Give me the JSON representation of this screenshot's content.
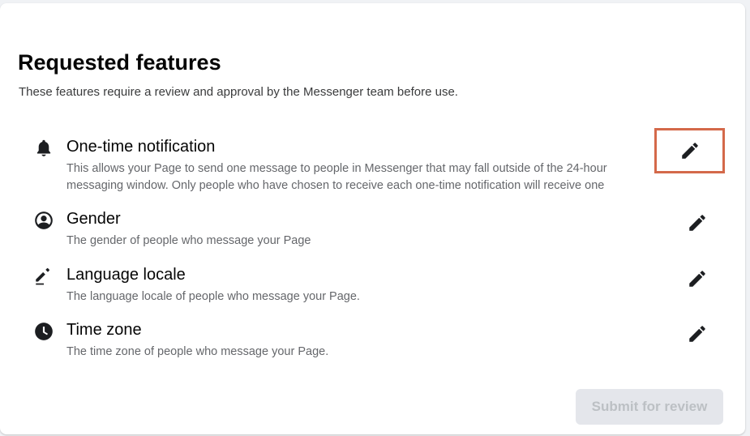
{
  "header": {
    "title": "Requested features",
    "subtitle": "These features require a review and approval by the Messenger team before use."
  },
  "features": [
    {
      "name": "One-time notification",
      "icon": "bell-icon",
      "description_lines": [
        "This allows your Page to send one message to people in Messenger that may fall outside of the 24-hour",
        "messaging window. Only people who have chosen to receive each one-time notification will receive one"
      ],
      "edit_icon": "pencil-icon",
      "edit_highlighted": true
    },
    {
      "name": "Gender",
      "icon": "person-circle-icon",
      "description_lines": [
        "The gender of people who message your Page"
      ],
      "edit_icon": "pencil-icon"
    },
    {
      "name": "Language locale",
      "icon": "pen-icon",
      "description_lines": [
        "The language locale of people who message your Page."
      ],
      "edit_icon": "pencil-icon"
    },
    {
      "name": "Time zone",
      "icon": "clock-icon",
      "description_lines": [
        "The time zone of people who message your Page."
      ],
      "edit_icon": "pencil-icon"
    }
  ],
  "footer": {
    "submit_label": "Submit for review",
    "submit_disabled": true
  },
  "colors": {
    "highlight_border": "#d4694a",
    "disabled_button_bg": "#e4e6eb",
    "disabled_button_text": "#bcc0c4"
  }
}
